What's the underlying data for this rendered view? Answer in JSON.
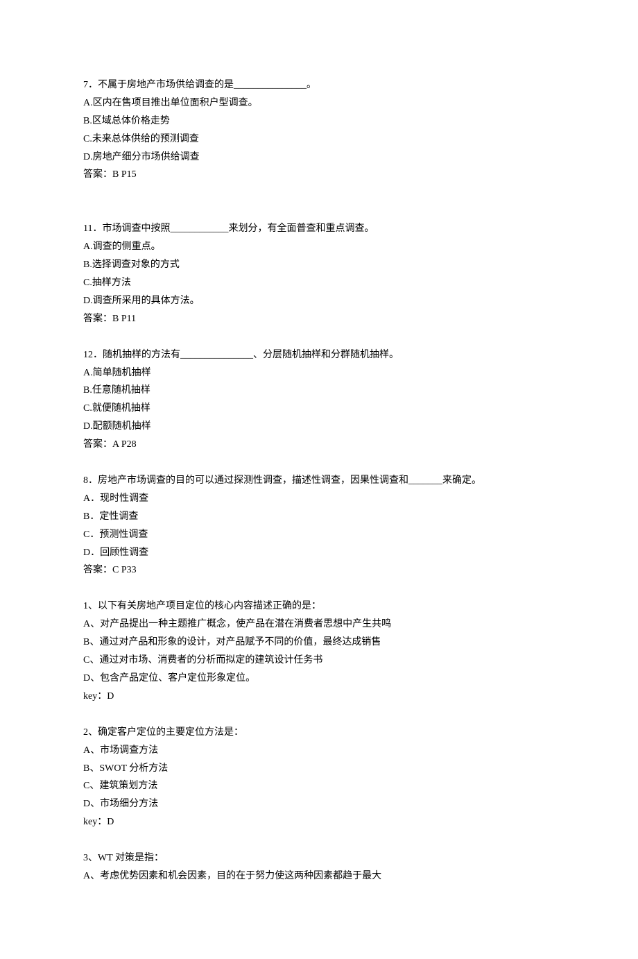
{
  "questions": [
    {
      "stem": "7．不属于房地产市场供给调查的是_______________。",
      "options": [
        "A.区内在售项目推出单位面积户型调查。",
        "B.区域总体价格走势",
        "C.未来总体供给的预测调查",
        "D.房地产细分市场供给调查"
      ],
      "answer": "答案：B P15"
    },
    {
      "stem": "11．市场调查中按照____________来划分，有全面普查和重点调查。",
      "options": [
        "A.调查的侧重点。",
        "B.选择调查对象的方式",
        "C.抽样方法",
        "D.调查所采用的具体方法。"
      ],
      "answer": "答案：B P11"
    },
    {
      "stem": "12．随机抽样的方法有_______________、分层随机抽样和分群随机抽样。",
      "options": [
        "A.简单随机抽样",
        "B.任意随机抽样",
        "C.就便随机抽样",
        "D.配额随机抽样"
      ],
      "answer": "答案：A P28"
    },
    {
      "stem": "8．房地产市场调查的目的可以通过探测性调查，描述性调查，因果性调查和_______来确定。",
      "options": [
        "A．现时性调查",
        "B．定性调查",
        "C．预测性调查",
        "D．回顾性调查"
      ],
      "answer": "答案：C P33"
    },
    {
      "stem": "1、以下有关房地产项目定位的核心内容描述正确的是：",
      "options": [
        "A、对产品提出一种主题推广概念，使产品在潜在消费者思想中产生共鸣",
        "B、通过对产品和形象的设计，对产品赋予不同的价值，最终达成销售",
        "C、通过对市场、消费者的分析而拟定的建筑设计任务书",
        "D、包含产品定位、客户定位形象定位。"
      ],
      "answer": "key：D"
    },
    {
      "stem": "2、确定客户定位的主要定位方法是：",
      "options": [
        "A、市场调查方法",
        "B、SWOT 分析方法",
        "C、建筑策划方法",
        "D、市场细分方法"
      ],
      "answer": "key：D"
    },
    {
      "stem": "3、WT 对策是指：",
      "options": [
        "A、考虑优势因素和机会因素，目的在于努力使这两种因素都趋于最大"
      ],
      "answer": ""
    }
  ]
}
